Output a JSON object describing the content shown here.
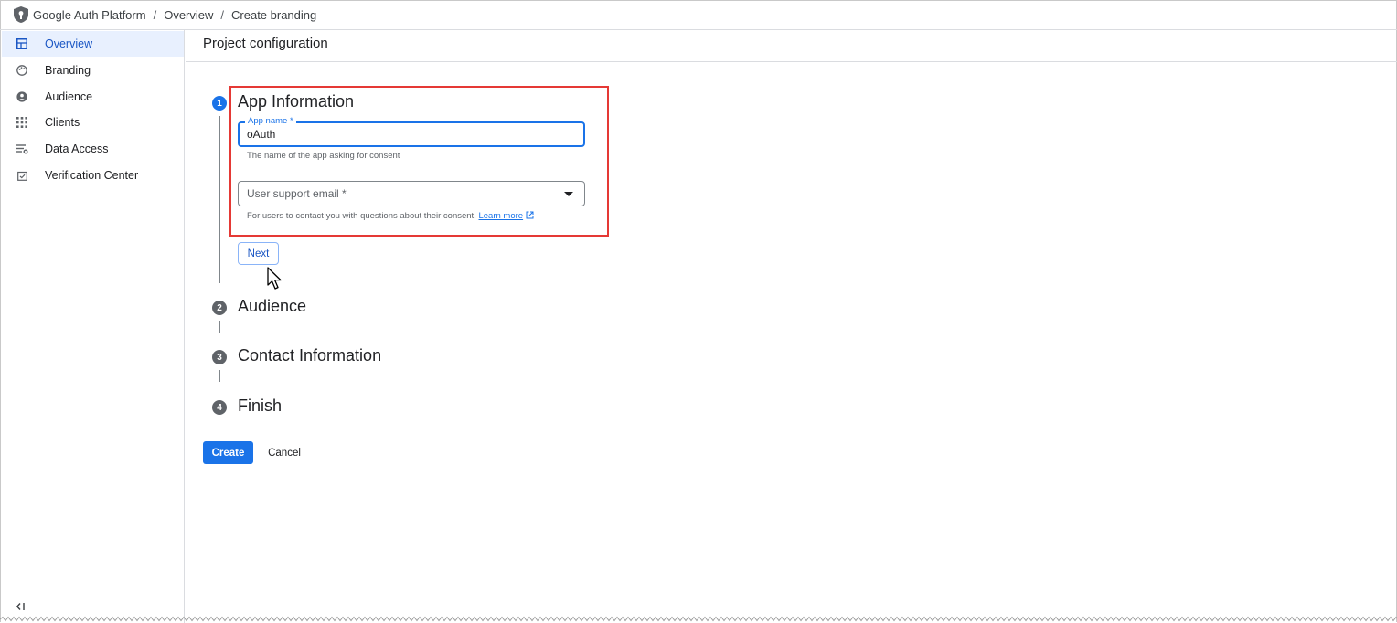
{
  "breadcrumb": {
    "items": [
      "Google Auth Platform",
      "Overview",
      "Create branding"
    ],
    "separator": "/"
  },
  "sidebar": {
    "items": [
      {
        "label": "Overview",
        "icon": "dashboard-icon",
        "active": true
      },
      {
        "label": "Branding",
        "icon": "palette-icon",
        "active": false
      },
      {
        "label": "Audience",
        "icon": "person-icon",
        "active": false
      },
      {
        "label": "Clients",
        "icon": "grid-icon",
        "active": false
      },
      {
        "label": "Data Access",
        "icon": "filter-list-icon",
        "active": false
      },
      {
        "label": "Verification Center",
        "icon": "checkbox-icon",
        "active": false
      }
    ],
    "collapse_icon": "collapse-icon"
  },
  "header": {
    "title": "Project configuration"
  },
  "steps": [
    {
      "number": "1",
      "title": "App Information",
      "active": true
    },
    {
      "number": "2",
      "title": "Audience",
      "active": false
    },
    {
      "number": "3",
      "title": "Contact Information",
      "active": false
    },
    {
      "number": "4",
      "title": "Finish",
      "active": false
    }
  ],
  "form": {
    "app_name": {
      "label": "App name *",
      "value": "oAuth",
      "helper": "The name of the app asking for consent"
    },
    "support_email": {
      "placeholder": "User support email *",
      "helper": "For users to contact you with questions about their consent.",
      "link": "Learn more"
    },
    "next_label": "Next"
  },
  "actions": {
    "create_label": "Create",
    "cancel_label": "Cancel"
  },
  "colors": {
    "accent": "#1a73e8",
    "highlight_border": "#e53935",
    "active_nav_bg": "#e8f0fe"
  }
}
